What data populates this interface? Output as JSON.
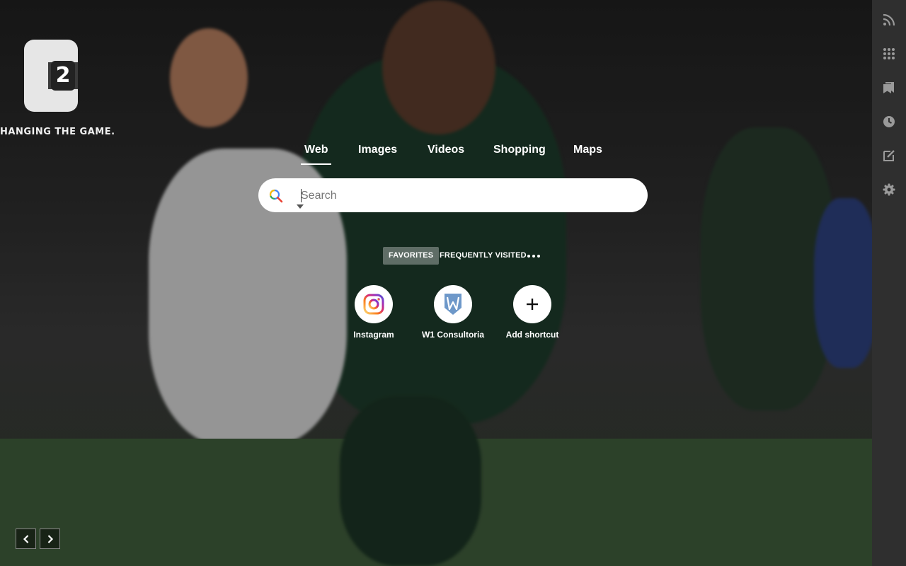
{
  "logo": {
    "mark_text": "2",
    "tagline": "HANGING THE GAME."
  },
  "tabs": [
    {
      "label": "Web",
      "active": true
    },
    {
      "label": "Images",
      "active": false
    },
    {
      "label": "Videos",
      "active": false
    },
    {
      "label": "Shopping",
      "active": false
    },
    {
      "label": "Maps",
      "active": false
    }
  ],
  "search": {
    "placeholder": "Search",
    "value": "",
    "engine_icon": "search-engine-icon"
  },
  "categories": {
    "items": [
      {
        "label": "FAVORITES",
        "active": true
      },
      {
        "label": "FREQUENTLY VISITED",
        "active": false
      }
    ],
    "more_icon": "more-dots-icon"
  },
  "shortcuts": [
    {
      "label": "Instagram",
      "icon": "instagram-icon"
    },
    {
      "label": "W1 Consultoria",
      "icon": "w1-consultoria-icon"
    },
    {
      "label": "Add shortcut",
      "icon": "plus-icon"
    }
  ],
  "sidebar": {
    "items": [
      {
        "icon": "rss-icon"
      },
      {
        "icon": "apps-grid-icon"
      },
      {
        "icon": "bookmarks-icon"
      },
      {
        "icon": "history-icon"
      },
      {
        "icon": "notes-icon"
      },
      {
        "icon": "settings-gear-icon"
      }
    ]
  },
  "nav": {
    "prev_icon": "chevron-left-icon",
    "next_icon": "chevron-right-icon"
  },
  "colors": {
    "sidebar_bg": "#2f2f2f",
    "search_bg": "#ffffff",
    "active_tab_underline": "#ffffff",
    "instagram_gradient": [
      "#feda75",
      "#d62976",
      "#962fbf",
      "#4f5bd5"
    ],
    "w1_blue": "#6e98c9"
  }
}
